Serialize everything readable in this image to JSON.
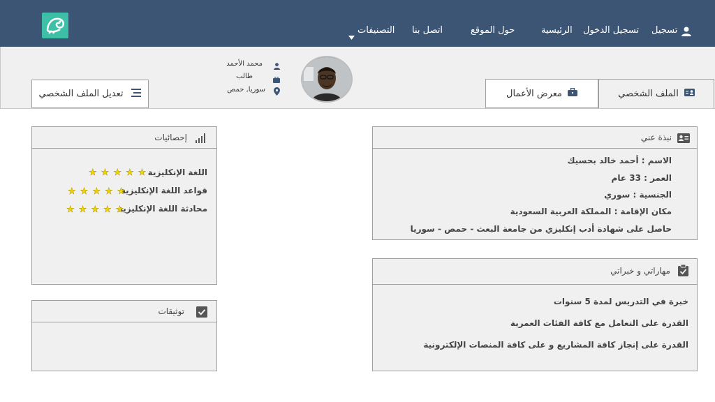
{
  "nav": {
    "register": "تسجيل",
    "login": "تسجيل الدخول",
    "home": "الرئيسية",
    "about": "حول الموقع",
    "contact": "اتصل بنا",
    "categories": "التصنيفات"
  },
  "profile": {
    "tab_profile": "الملف الشخصي",
    "tab_portfolio": "معرض الأعمال",
    "edit_button": "تعديل الملف الشخصي",
    "name": "محمد الأحمد",
    "role": "طالب",
    "location": "سوريا, حمص"
  },
  "about": {
    "title": "نبذة عني",
    "lines": [
      "الاسم : أحمد خالد بحسيك",
      "العمر : 33 عام",
      "الجنسية : سوري",
      "مكان الإقامة : المملكة العربية السعودية",
      "حاصل على شهادة أدب إنكليزي من جامعة البعث - حمص - سوريا"
    ]
  },
  "skills": {
    "title": "مهاراتي و خبراتي",
    "lines": [
      "خبرة في التدريس لمدة 5 سنوات",
      "القدرة على التعامل مع كافة الفئات العمرية",
      "القدرة على إنجاز كافة المشاريع و على كافة المنصات الإلكترونية"
    ]
  },
  "stats": {
    "title": "إحصائيات",
    "items": [
      {
        "label": "اللغة الإنكليزية",
        "rating": 5
      },
      {
        "label": "قواعد اللغة الإنكليزية",
        "rating": 5
      },
      {
        "label": "محادثة اللغة الإنكليزية",
        "rating": 5
      }
    ]
  },
  "certs": {
    "title": "توثيقات"
  },
  "colors": {
    "navbar": "#3d5575",
    "logo": "#3dbfa8",
    "star": "#f0d500",
    "panel": "#f0f0f0"
  },
  "icons": [
    "user-icon",
    "chevron-down-icon",
    "id-card-icon",
    "briefcase-icon",
    "menu-icon",
    "location-icon",
    "signal-bars-icon",
    "checkbox-icon",
    "clipboard-check-icon",
    "star-icon"
  ]
}
